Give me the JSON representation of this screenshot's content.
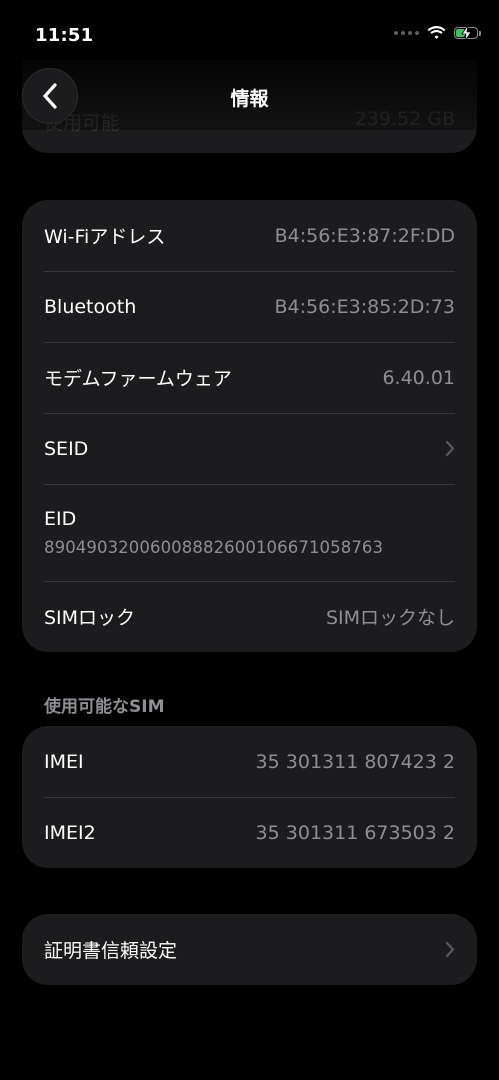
{
  "status_bar": {
    "time": "11:51"
  },
  "ghost_row": {
    "label": "使用可能",
    "value": "239.52 GB"
  },
  "nav": {
    "title": "情報"
  },
  "network_card": {
    "wifi_label": "Wi-Fiアドレス",
    "wifi_value": "B4:56:E3:87:2F:DD",
    "bluetooth_label": "Bluetooth",
    "bluetooth_value": "B4:56:E3:85:2D:73",
    "modem_label": "モデムファームウェア",
    "modem_value": "6.40.01",
    "seid_label": "SEID",
    "eid_label": "EID",
    "eid_value": "89049032006008882600106671058763",
    "sim_lock_label": "SIMロック",
    "sim_lock_value": "SIMロックなし"
  },
  "sim_section": {
    "header": "使用可能なSIM",
    "imei_label": "IMEI",
    "imei_value": "35 301311 807423 2",
    "imei2_label": "IMEI2",
    "imei2_value": "35 301311 673503 2"
  },
  "cert_card": {
    "label": "証明書信頼設定"
  },
  "colors": {
    "background": "#000000",
    "card": "#1c1c1e",
    "separator": "#38383a",
    "secondary_text": "#8e8e93",
    "battery_green": "#34c759"
  },
  "icons": {
    "back": "chevron-left-icon",
    "disclosure": "chevron-right-icon",
    "wifi": "wifi-icon",
    "battery": "battery-charging-icon",
    "cellular": "cellular-dots-icon"
  }
}
